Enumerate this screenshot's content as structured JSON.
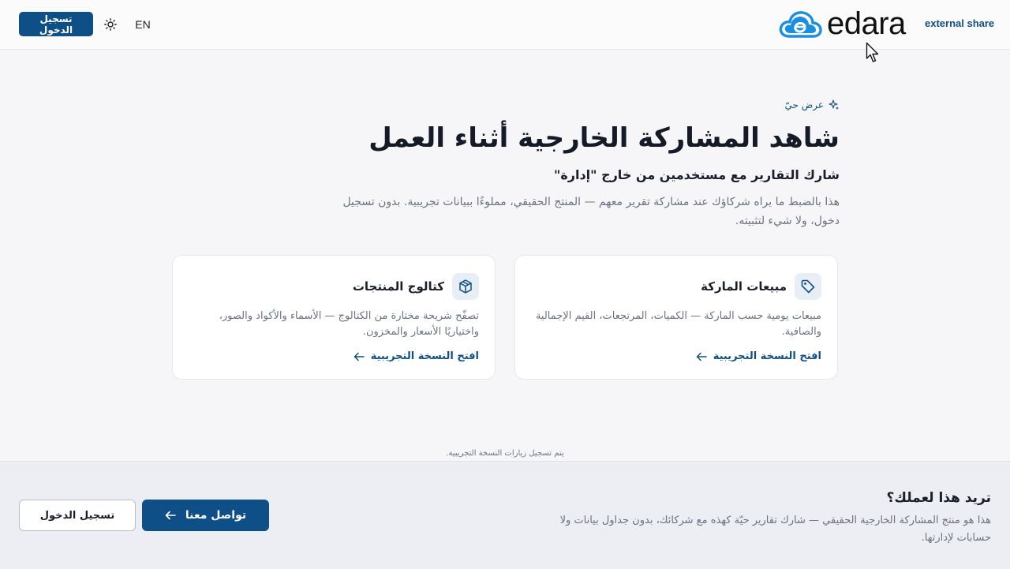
{
  "header": {
    "login_label": "تسجيل الدخول",
    "lang_label": "EN",
    "logo_text": "edara",
    "external_share_label": "external share"
  },
  "hero": {
    "eyebrow": "عرض حيّ",
    "title": "شاهد المشاركة الخارجية أثناء العمل",
    "subtitle": "شارك التقارير مع مستخدمين من خارج \"إدارة\"",
    "description": "هذا بالضبط ما يراه شركاؤك عند مشاركة تقرير معهم — المنتج الحقيقي، مملوءًا ببيانات تجريبية. بدون تسجيل دخول، ولا شيء لتثبيته."
  },
  "cards": [
    {
      "title": "مبيعات الماركة",
      "description": "مبيعات يومية حسب الماركة — الكميات، المرتجعات، القيم الإجمالية والصافية.",
      "link_label": "افتح النسخة التجريبية",
      "icon": "tag-icon"
    },
    {
      "title": "كتالوج المنتجات",
      "description": "تصفّح شريحة مختارة من الكتالوج — الأسماء والأكواد والصور، واختياريًا الأسعار والمخزون.",
      "link_label": "افتح النسخة التجريبية",
      "icon": "box-icon"
    }
  ],
  "tracking_note": "يتم تسجيل زيارات النسخة التجريبية.",
  "footer": {
    "title": "تريد هذا لعملك؟",
    "description": "هذا هو منتج المشاركة الخارجية الحقيقي — شارك تقارير حيّة كهذه مع شركائك، بدون جداول بيانات ولا حسابات لإدارتها.",
    "contact_label": "تواصل معنا",
    "login_label": "تسجيل الدخول"
  },
  "colors": {
    "brand": "#0f4f87",
    "logo_cloud": "#1a8fe0",
    "page_bg": "#f6f6f9",
    "footer_bg": "#eceef3"
  }
}
